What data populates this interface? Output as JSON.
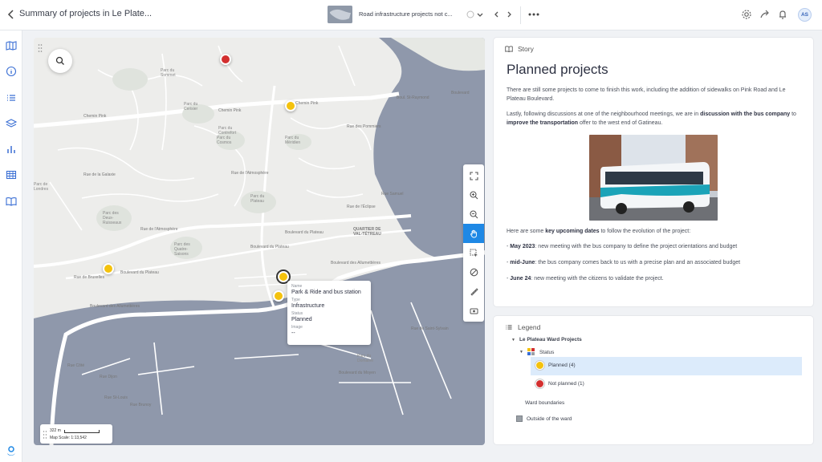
{
  "app": {
    "title": "Summary of projects in Le Plate...",
    "doc_title": "Road infrastructure projects not c...",
    "avatar_initials": "AS",
    "accent_color": "#1e88e5"
  },
  "rail": {
    "items": [
      "map-icon",
      "info-icon",
      "list-icon",
      "layers-icon",
      "chart-icon",
      "table-icon",
      "book-icon"
    ]
  },
  "map": {
    "labels": {
      "parc_du_sommet": "Parc du\nSommet",
      "parc_du_cerisier": "Parc du\nCerisier",
      "parc_du_contrefort": "Parc du\nContrefort",
      "parc_du_cosmos": "Parc du\nCosmos",
      "parc_du_meridien": "Parc du\nMéridien",
      "parc_de_londres": "Parc de\nLondres",
      "parc_du_plateau": "Parc du\nPlateau",
      "parc_des_deux_ruisseaux": "Parc des\nDeux-\nRuisseaux",
      "parc_des_quatre_saisons": "Parc des\nQuatre-\nSaisons",
      "quartier": "QUARTIER DE\nVAL-TÉTREAU",
      "parc_du_domaine": "Parc du\nDomaine"
    },
    "roads": {
      "chemin_pink_1": "Chemin Pink",
      "chemin_pink_2": "Chemin Pink",
      "chemin_pink_3": "Chemin Pink",
      "st_raymond": "Boul. St-Raymond",
      "boulevard": "Boulevard",
      "atmosphere_1": "Rue de l'Atmosphère",
      "atmosphere_2": "Rue de l'Atmosphère",
      "galaxie": "Rue de la Galaxie",
      "eclipse": "Rue de l'Éclipse",
      "pommiers": "Rue des Pommiers",
      "plateau_1": "Boulevard du Plateau",
      "plateau_2": "Boulevard du Plateau",
      "plateau_3": "Boulevard du Plateau",
      "bruxelles": "Rue de Bruxelles",
      "allumettieres_1": "Boulevard des Allumettières",
      "allumettieres_2": "Boulevard des Allumettières",
      "samuel": "Rue Samuel",
      "cote": "Rue Côté",
      "dijon": "Rue Dijon",
      "brunoy": "Rue Brunoy",
      "st_louis": "Rue St-Louis",
      "moyen": "Boulevard du Moyen",
      "saint_sylvain": "Rue de Saint-Sylvain"
    },
    "markers": [
      {
        "status": "Not planned",
        "color": "#d32f2f"
      },
      {
        "status": "Planned",
        "color": "#f4c20d"
      },
      {
        "status": "Planned",
        "color": "#f4c20d"
      },
      {
        "status": "Planned",
        "color": "#f4c20d"
      },
      {
        "status": "Planned",
        "color": "#f4c20d"
      }
    ],
    "popup": {
      "name_label": "Name",
      "name_value": "Park & Ride and bus station",
      "type_label": "Type",
      "type_value": "Infrastructure",
      "status_label": "Status",
      "status_value": "Planned",
      "image_label": "Image",
      "image_value": "--"
    },
    "scale": {
      "distance": "322 m",
      "text": "Map Scale: 1:13,542"
    },
    "tools": [
      "fullscreen-icon",
      "zoom-in-icon",
      "zoom-out-icon",
      "pan-hand-icon",
      "select-area-icon",
      "no-identify-icon",
      "measure-icon",
      "basemap-icon"
    ]
  },
  "story": {
    "header": "Story",
    "title": "Planned projects",
    "p1": "There are still some projects to come to finish this work, including the addition of sidewalks on Pink Road and Le Plateau Boulevard.",
    "p2_a": "Lastly, following discussions at one of the neighbourhood meetings, we are in ",
    "p2_b": "discussion with the bus company",
    "p2_c": " to ",
    "p2_d": "improve the transportation",
    "p2_e": " offer to the west end of Gatineau.",
    "p3_a": "Here are some ",
    "p3_b": "key upcoming dates",
    "p3_c": " to follow the evolution of the project:",
    "bullets": [
      {
        "date": "May 2023",
        "text": ": new meeting with the bus company to define the project orientations and budget"
      },
      {
        "date": "mid-June",
        "text": ": the bus company comes back to us with a precise plan and an associated budget"
      },
      {
        "date": "June 24",
        "text": ": new meeting with the citizens to validate the project."
      }
    ]
  },
  "legend": {
    "header": "Legend",
    "group": "Le Plateau Ward Projects",
    "sub": "Status",
    "items": [
      {
        "label": "Planned (4)",
        "color": "#f4c20d"
      },
      {
        "label": "Not planned (1)",
        "color": "#d32f2f"
      }
    ],
    "boundaries": "Ward boundaries",
    "outside": "Outside of the ward"
  }
}
